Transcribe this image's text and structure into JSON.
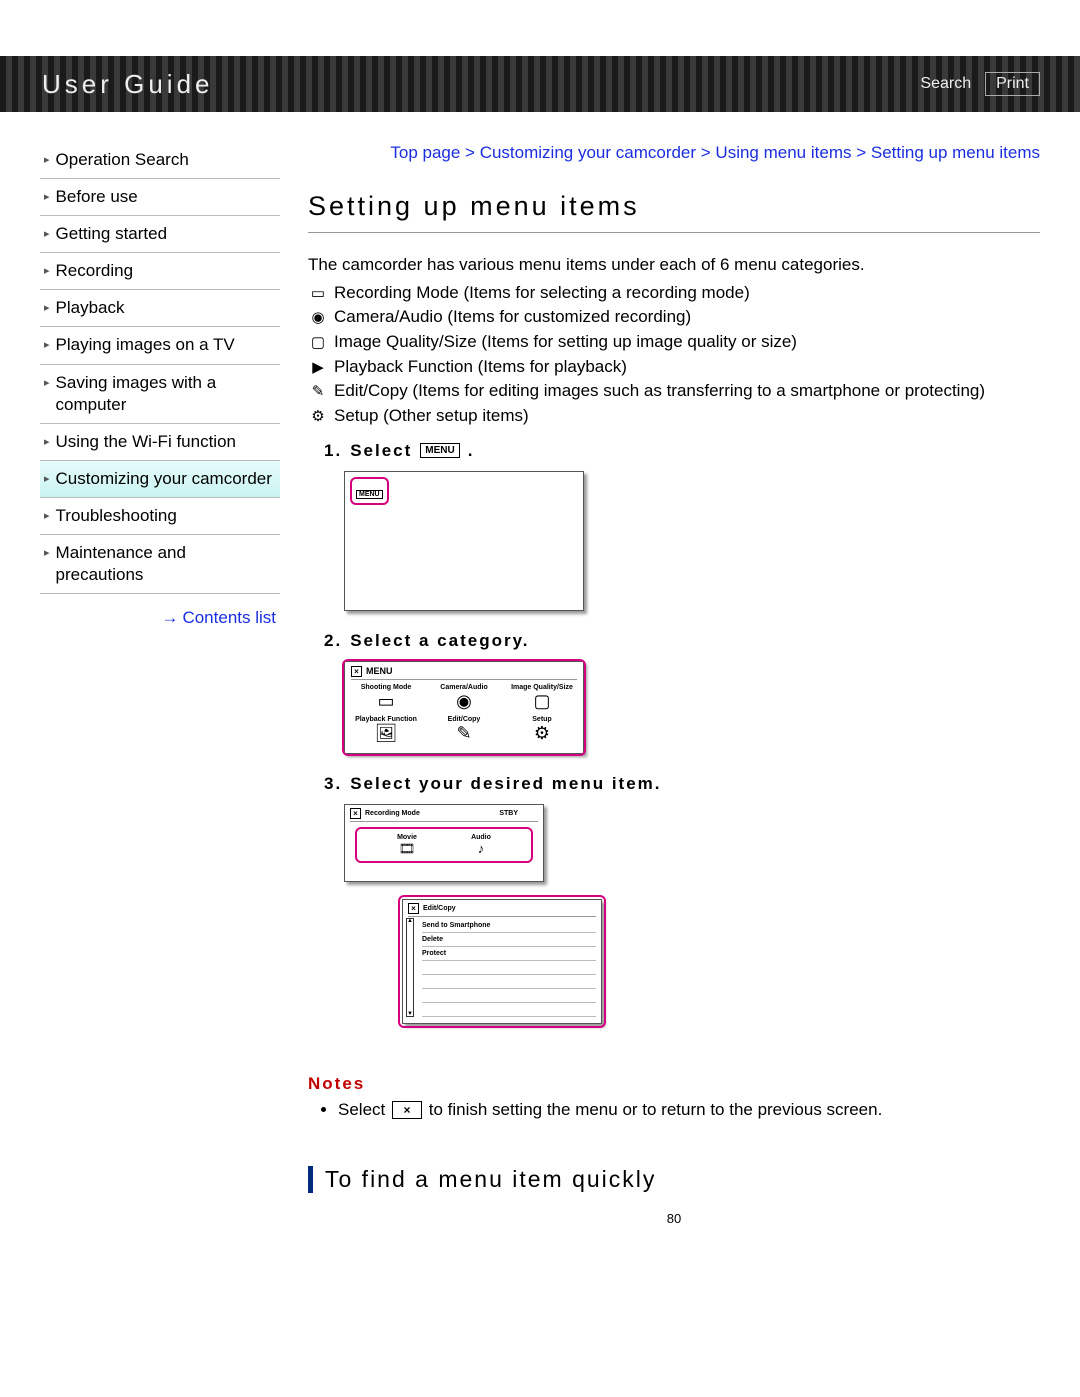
{
  "header": {
    "title": "User Guide",
    "search": "Search",
    "print": "Print"
  },
  "sidebar": {
    "items": [
      "Operation Search",
      "Before use",
      "Getting started",
      "Recording",
      "Playback",
      "Playing images on a TV",
      "Saving images with a computer",
      "Using the Wi-Fi function",
      "Customizing your camcorder",
      "Troubleshooting",
      "Maintenance and precautions"
    ],
    "active_index": 8,
    "contents": "Contents list"
  },
  "breadcrumb": "Top page > Customizing your camcorder > Using menu items > Setting up menu items",
  "page_title": "Setting up menu items",
  "intro": "The camcorder has various menu items under each of 6 menu categories.",
  "categories": [
    {
      "icon": "▭",
      "text": "Recording Mode (Items for selecting a recording mode)"
    },
    {
      "icon": "◉",
      "text": "Camera/Audio (Items for customized recording)"
    },
    {
      "icon": "▢",
      "text": "Image Quality/Size (Items for setting up image quality or size)"
    },
    {
      "icon": "▶",
      "text": "Playback Function (Items for playback)"
    },
    {
      "icon": "✎",
      "text": "Edit/Copy (Items for editing images such as transferring to a smartphone or protecting)"
    },
    {
      "icon": "⚙",
      "text": "Setup (Other setup items)"
    }
  ],
  "steps": {
    "s1": {
      "num": "1.",
      "label": "Select",
      "btn": "MENU"
    },
    "s2": {
      "num": "2.",
      "label": "Select a category."
    },
    "s3": {
      "num": "3.",
      "label": "Select your desired menu item."
    }
  },
  "fig2": {
    "title": "MENU",
    "cells": [
      {
        "lbl": "Shooting Mode",
        "ic": "▭"
      },
      {
        "lbl": "Camera/Audio",
        "ic": "◉"
      },
      {
        "lbl": "Image Quality/Size",
        "ic": "▢"
      },
      {
        "lbl": "Playback Function",
        "ic": "🖼"
      },
      {
        "lbl": "Edit/Copy",
        "ic": "✎"
      },
      {
        "lbl": "Setup",
        "ic": "⚙"
      }
    ]
  },
  "fig3a": {
    "title": "Recording Mode",
    "stby": "STBY",
    "opt1": {
      "l": "Movie",
      "i": "🎞"
    },
    "opt2": {
      "l": "Audio",
      "i": "♪"
    }
  },
  "fig3b": {
    "title": "Edit/Copy",
    "items": [
      "Send to Smartphone",
      "Delete",
      "Protect"
    ]
  },
  "notes": {
    "title": "Notes",
    "bullet_a": "Select",
    "bullet_b": "to finish setting the menu or to return to the previous screen."
  },
  "h2": "To find a menu item quickly",
  "pagenum": "80"
}
